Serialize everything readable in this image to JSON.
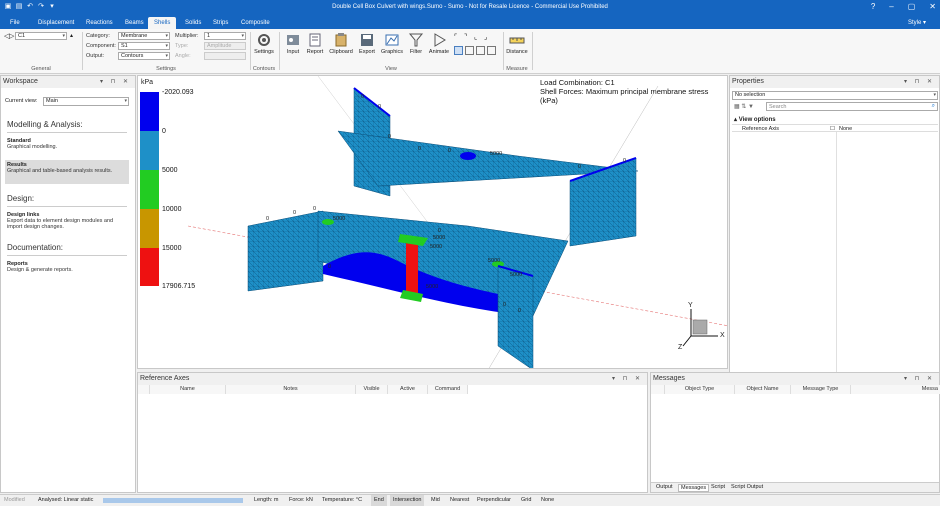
{
  "window": {
    "title": "Double Cell Box Culvert with wings.Sumo - Sumo - Not for Resale Licence - Commercial Use Prohibited",
    "buttons": [
      "?",
      "–",
      "▢",
      "✕"
    ]
  },
  "menu": {
    "tabs": [
      "File",
      "Displacement",
      "Reactions",
      "Beams",
      "Shells",
      "Solids",
      "Strips",
      "Composite"
    ],
    "active_tab": "Shells",
    "style_label": "Style"
  },
  "ribbon": {
    "nav_value": "C1",
    "groups": {
      "general": "General",
      "settings": "Settings",
      "contours": "Contours",
      "view": "View",
      "measure": "Measure"
    },
    "settings": {
      "category_label": "Category:",
      "category_value": "Membrane",
      "component_label": "Component:",
      "component_value": "S1",
      "output_label": "Output:",
      "output_value": "Contours",
      "multiplier_label": "Multiplier:",
      "multiplier_value": "1",
      "type_label": "Type:",
      "type_value": "Amplitude",
      "angle_label": "Angle:",
      "angle_value": ""
    },
    "buttons": {
      "settings": "Settings",
      "input": "Input",
      "report": "Report",
      "clipboard": "Clipboard",
      "export": "Export",
      "graphics": "Graphics",
      "filter": "Filter",
      "animate": "Animate",
      "distance": "Distance"
    }
  },
  "workspace": {
    "title": "Workspace",
    "current_view_label": "Current view:",
    "current_view_value": "Main",
    "sections": [
      {
        "heading": "Modelling & Analysis:",
        "items": [
          {
            "title": "Standard",
            "desc": "Graphical modelling."
          },
          {
            "title": "Results",
            "desc": "Graphical and table-based analysis results."
          }
        ]
      },
      {
        "heading": "Design:",
        "items": [
          {
            "title": "Design links",
            "desc": "Export data to element design modules and import design changes."
          }
        ]
      },
      {
        "heading": "Documentation:",
        "items": [
          {
            "title": "Reports",
            "desc": "Design & generate reports."
          }
        ]
      }
    ]
  },
  "viewport": {
    "legend_unit": "kPa",
    "legend_labels": [
      "-2020.093",
      "0",
      "5000",
      "10000",
      "15000",
      "17906.715"
    ],
    "legend_colors": [
      "#0000ee",
      "#1e90c8",
      "#22cc22",
      "#c89600",
      "#ee1111"
    ],
    "load_combination": "Load Combination: C1",
    "shell_forces": "Shell Forces: Maximum principal membrane stress (kPa)",
    "axes": {
      "x": "X",
      "y": "Y",
      "z": "Z"
    },
    "model_labels": [
      "0",
      "0",
      "0",
      "0",
      "0",
      "0",
      "0",
      "0",
      "0",
      "0",
      "0",
      "5000",
      "5000",
      "5000",
      "5000",
      "5000",
      "5000",
      "5000",
      "0",
      "0",
      "0"
    ]
  },
  "properties": {
    "title": "Properties",
    "selection": "No selection",
    "search_placeholder": "Search",
    "group": "View options",
    "row_label": "Reference Axis",
    "row_value": "None"
  },
  "reference_axes": {
    "title": "Reference Axes",
    "columns": [
      "Name",
      "Notes",
      "Visible",
      "Active",
      "Command"
    ]
  },
  "messages": {
    "title": "Messages",
    "columns": [
      "Object Type",
      "Object Name",
      "Message Type",
      "Messa"
    ],
    "tabs": [
      "Output",
      "Messages",
      "Script",
      "Script Output"
    ],
    "active_tab": "Messages"
  },
  "status_bar": {
    "modified": "Modified",
    "analysis": "Analysed: Linear static",
    "length": "Length: m",
    "force": "Force: kN",
    "temperature": "Temperature: °C",
    "snaps": [
      "End",
      "Intersection",
      "Mid",
      "Nearest",
      "Perpendicular",
      "Grid",
      "None"
    ]
  }
}
